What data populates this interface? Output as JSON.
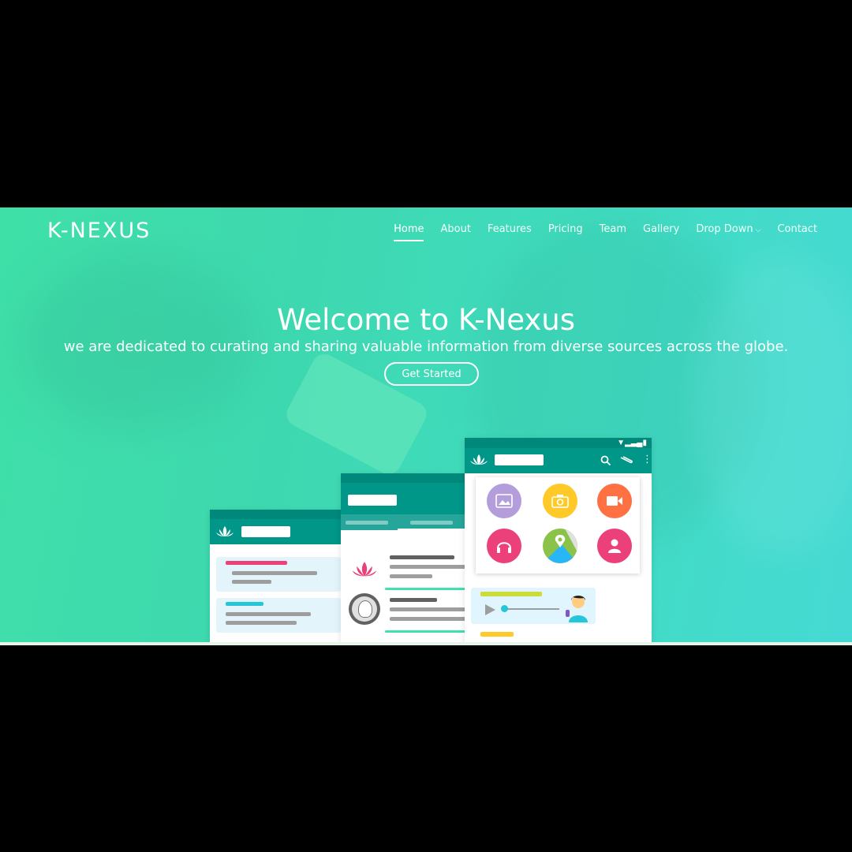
{
  "brand": {
    "logo": "K-NEXUS"
  },
  "nav": {
    "items": [
      {
        "label": "Home",
        "active": true
      },
      {
        "label": "About",
        "active": false
      },
      {
        "label": "Features",
        "active": false
      },
      {
        "label": "Pricing",
        "active": false
      },
      {
        "label": "Team",
        "active": false
      },
      {
        "label": "Gallery",
        "active": false
      },
      {
        "label": "Drop Down",
        "active": false
      },
      {
        "label": "Contact",
        "active": false
      }
    ],
    "dropdown_chevron": "chevron-down-icon"
  },
  "hero": {
    "title": "Welcome to K-Nexus",
    "subtitle": "we are dedicated to curating and sharing valuable information from diverse sources across the globe.",
    "cta_label": "Get Started"
  },
  "colors": {
    "accent": "#009688",
    "pink": "#ec407a",
    "purple": "#b39ddb",
    "yellow": "#ffca28",
    "orange": "#ff7043",
    "green": "#8bc34a"
  },
  "icons": {
    "app_grid": [
      "image-icon",
      "camera-icon",
      "video-icon",
      "headphones-icon",
      "map-icon",
      "contact-icon"
    ],
    "toolbar": [
      "lotus-icon",
      "search-icon",
      "attachment-icon",
      "more-vert-icon"
    ]
  }
}
